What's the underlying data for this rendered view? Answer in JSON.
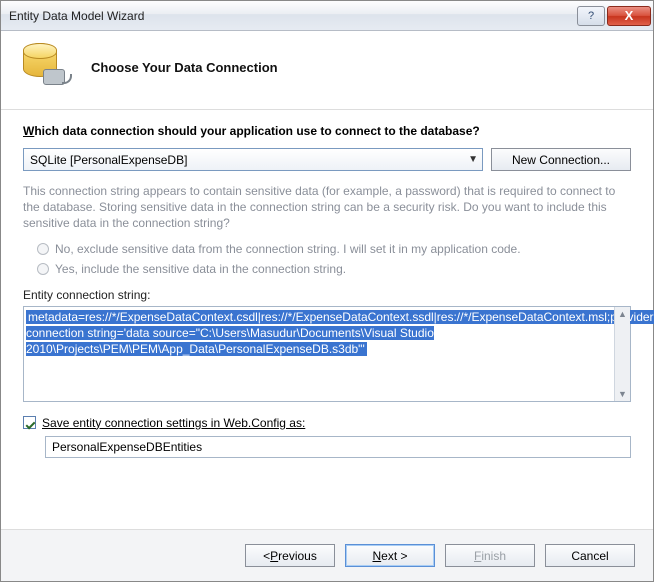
{
  "window": {
    "title": "Entity Data Model Wizard",
    "help_glyph": "?",
    "close_glyph": "X"
  },
  "header": {
    "heading": "Choose Your Data Connection"
  },
  "body": {
    "prompt_pre": "W",
    "prompt_rest": "hich data connection should your application use to connect to the database?",
    "connection_selected": "SQLite [PersonalExpenseDB]",
    "new_connection_label": "New Connection...",
    "info_text": "This connection string appears to contain sensitive data (for example, a password) that is required to connect to the database. Storing sensitive data in the connection string can be a security risk. Do you want to include this sensitive data in the connection string?",
    "radio_no": "No, exclude sensitive data from the connection string. I will set it in my application code.",
    "radio_yes": "Yes, include the sensitive data in the connection string.",
    "connstr_label_pre": "Entity connection strin",
    "connstr_label_ul": "g",
    "connstr_label_post": ":",
    "connection_string": "metadata=res://*/ExpenseDataContext.csdl|res://*/ExpenseDataContext.ssdl|res://*/ExpenseDataContext.msl;provider=System.Data.SQLite;provider connection string='data source=\"C:\\Users\\Masudur\\Documents\\Visual Studio 2010\\Projects\\PEM\\PEM\\App_Data\\PersonalExpenseDB.s3db\"'",
    "save_checkbox_checked": true,
    "save_label_ul": "S",
    "save_label_rest": "ave entity connection settings in Web.Config as:",
    "save_name_value": "PersonalExpenseDBEntities"
  },
  "footer": {
    "previous": "< Previous",
    "next": "Next >",
    "finish": "Finish",
    "cancel": "Cancel"
  }
}
